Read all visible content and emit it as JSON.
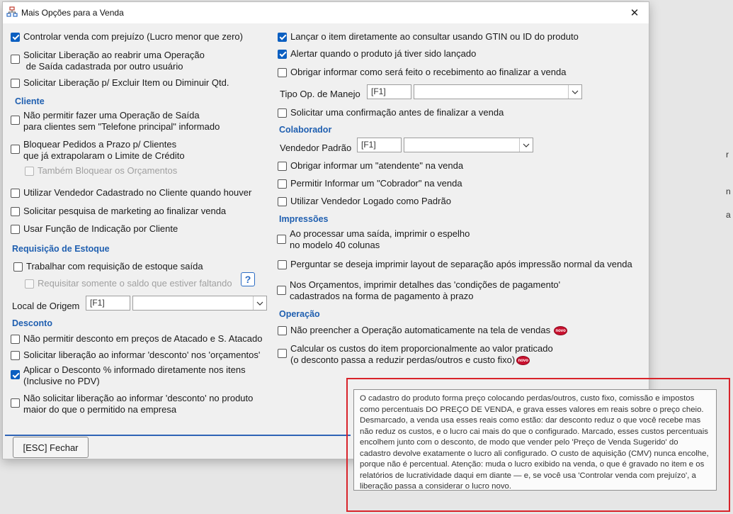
{
  "desktop": {
    "letters": [
      "r",
      "n",
      "a"
    ]
  },
  "window": {
    "title": "Mais Opções para a Venda",
    "close": "✕"
  },
  "left": {
    "controlar": {
      "label": "Controlar venda com prejuízo (Lucro menor que zero)",
      "checked": true
    },
    "liberacao_reabrir": {
      "line1": "Solicitar Liberação ao reabrir uma Operação",
      "line2": " de Saída cadastrada por outro usuário",
      "checked": false
    },
    "liberacao_excluir": {
      "label": "Solicitar Liberação p/ Excluir Item ou Diminuir Qtd.",
      "checked": false
    },
    "cliente": {
      "header": "Cliente",
      "telefone": {
        "line1": "Não permitir fazer uma Operação de Saída",
        "line2": "para clientes sem \"Telefone principal\" informado",
        "checked": false
      },
      "bloquear": {
        "line1": "Bloquear Pedidos a Prazo p/ Clientes",
        "line2": "que já extrapolaram o Limite de Crédito",
        "checked": false
      },
      "orcamentos": {
        "label": "Também Bloquear os Orçamentos",
        "checked": false
      },
      "vendedor_cadastrado": {
        "label": "Utilizar Vendedor Cadastrado no Cliente quando houver",
        "checked": false
      },
      "marketing": {
        "label": "Solicitar pesquisa de marketing ao finalizar venda",
        "checked": false
      },
      "indicacao": {
        "label": "Usar Função de Indicação por Cliente",
        "checked": false
      }
    },
    "requisicao": {
      "header": "Requisição de Estoque",
      "trabalhar": {
        "label": "Trabalhar com requisição de estoque saída",
        "checked": false
      },
      "saldo": {
        "label": "Requisitar somente o saldo que estiver faltando",
        "checked": false
      },
      "help": "?",
      "local_label": "Local de Origem",
      "local_code": "[F1]"
    },
    "desconto": {
      "header": "Desconto",
      "atacado": {
        "label": "Não permitir desconto em preços de Atacado e S. Atacado",
        "checked": false
      },
      "orcamentos": {
        "label": "Solicitar liberação ao informar 'desconto' nos 'orçamentos'",
        "checked": false
      },
      "aplicar": {
        "line1": "Aplicar o Desconto % informado diretamente nos itens",
        "line2": "(Inclusive no PDV)",
        "checked": true
      },
      "nao_solicitar": {
        "line1": "Não solicitar liberação ao informar 'desconto' no produto",
        "line2": "maior do que o permitido na empresa",
        "checked": false
      }
    }
  },
  "right": {
    "gtin": {
      "label": "Lançar o item diretamente ao consultar usando GTIN ou ID do produto",
      "checked": true
    },
    "alertar": {
      "label": "Alertar quando o produto já tiver sido lançado",
      "checked": true
    },
    "obrigar_recebimento": {
      "label": "Obrigar informar como será feito o recebimento ao finalizar a venda",
      "checked": false
    },
    "tipo_op_label": "Tipo Op. de Manejo",
    "tipo_op_code": "[F1]",
    "confirmacao": {
      "label": "Solicitar uma confirmação antes de finalizar a venda",
      "checked": false
    },
    "colaborador": {
      "header": "Colaborador",
      "vendedor_label": "Vendedor Padrão",
      "vendedor_code": "[F1]",
      "atendente": {
        "label": "Obrigar informar um \"atendente\" na venda",
        "checked": false
      },
      "cobrador": {
        "label": "Permitir Informar um \"Cobrador\" na venda",
        "checked": false
      },
      "logado": {
        "label": "Utilizar Vendedor Logado como Padrão",
        "checked": false
      }
    },
    "impressoes": {
      "header": "Impressões",
      "espelho": {
        "line1": "Ao processar uma saída, imprimir o espelho",
        "line2": "no modelo 40 colunas",
        "checked": false
      },
      "separacao": {
        "label": "Perguntar se deseja imprimir layout de separação após impressão normal da venda",
        "checked": false
      },
      "orcamentos": {
        "line1": "Nos Orçamentos, imprimir detalhes das 'condições de pagamento'",
        "line2": "cadastrados na forma de pagamento à prazo",
        "checked": false
      }
    },
    "operacao": {
      "header": "Operação",
      "nao_preencher": {
        "label": "Não preencher a Operação automaticamente na tela de vendas",
        "checked": false
      },
      "custos": {
        "line1": "Calcular os custos do item proporcionalmente ao valor praticado",
        "line2": "(o desconto passa a reduzir perdas/outros e custo fixo)",
        "checked": false
      },
      "new_badge": "novo"
    }
  },
  "footer": {
    "close_button": "[ESC] Fechar"
  },
  "tooltip": {
    "text": "O cadastro do produto forma preço colocando perdas/outros, custo fixo, comissão e impostos como percentuais DO PREÇO DE VENDA, e grava esses valores em reais sobre o preço cheio. Desmarcado, a venda usa esses reais como estão: dar desconto reduz o que você recebe mas não reduz os custos, e o lucro cai mais do que o configurado. Marcado, esses custos percentuais encolhem junto com o desconto, de modo que vender pelo 'Preço de Venda Sugerido' do cadastro devolve exatamente o lucro ali configurado. O custo de aquisição (CMV) nunca encolhe, porque não é percentual. Atenção: muda o lucro exibido na venda, o que é gravado no item e os relatórios de lucratividade daqui em diante — e, se você usa 'Controlar venda com prejuízo', a liberação passa a considerar o lucro novo."
  },
  "colors": {
    "accent": "#1f5fb0",
    "checkbox": "#0b5fc1",
    "highlight": "#d8232a",
    "badge": "#c8102e"
  }
}
